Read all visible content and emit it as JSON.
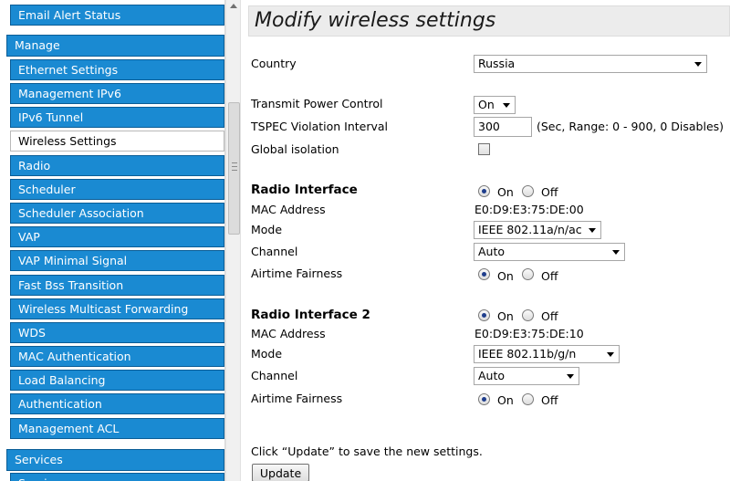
{
  "sidebar": {
    "items": [
      {
        "label": "Email Alert Status",
        "type": "item"
      },
      {
        "label": "Manage",
        "type": "group"
      },
      {
        "label": "Ethernet Settings",
        "type": "item"
      },
      {
        "label": "Management IPv6",
        "type": "item"
      },
      {
        "label": "IPv6 Tunnel",
        "type": "item"
      },
      {
        "label": "Wireless Settings",
        "type": "item",
        "selected": true
      },
      {
        "label": "Radio",
        "type": "item"
      },
      {
        "label": "Scheduler",
        "type": "item"
      },
      {
        "label": "Scheduler Association",
        "type": "item"
      },
      {
        "label": "VAP",
        "type": "item"
      },
      {
        "label": "VAP Minimal Signal",
        "type": "item"
      },
      {
        "label": "Fast Bss Transition",
        "type": "item"
      },
      {
        "label": "Wireless Multicast Forwarding",
        "type": "item"
      },
      {
        "label": "WDS",
        "type": "item"
      },
      {
        "label": "MAC Authentication",
        "type": "item"
      },
      {
        "label": "Load Balancing",
        "type": "item"
      },
      {
        "label": "Authentication",
        "type": "item"
      },
      {
        "label": "Management ACL",
        "type": "item"
      },
      {
        "label": "Services",
        "type": "group"
      },
      {
        "label": "Services",
        "type": "item"
      }
    ]
  },
  "main": {
    "title": "Modify wireless settings",
    "country": {
      "label": "Country",
      "value": "Russia"
    },
    "transmit_power": {
      "label": "Transmit Power Control",
      "value": "On"
    },
    "tspec": {
      "label": "TSPEC Violation Interval",
      "value": "300",
      "hint": "(Sec, Range: 0 - 900, 0 Disables)"
    },
    "global_isolation": {
      "label": "Global isolation",
      "checked": false
    },
    "radio1": {
      "title": "Radio Interface",
      "on_label": "On",
      "off_label": "Off",
      "state": "On",
      "mac_label": "MAC Address",
      "mac": "E0:D9:E3:75:DE:00",
      "mode_label": "Mode",
      "mode": "IEEE 802.11a/n/ac",
      "channel_label": "Channel",
      "channel": "Auto",
      "airtime_label": "Airtime Fairness",
      "airtime_state": "On"
    },
    "radio2": {
      "title": "Radio Interface 2",
      "on_label": "On",
      "off_label": "Off",
      "state": "On",
      "mac_label": "MAC Address",
      "mac": "E0:D9:E3:75:DE:10",
      "mode_label": "Mode",
      "mode": "IEEE 802.11b/g/n",
      "channel_label": "Channel",
      "channel": "Auto",
      "airtime_label": "Airtime Fairness",
      "airtime_state": "On"
    },
    "footer_text": "Click “Update” to save the new settings.",
    "update_label": "Update"
  },
  "colors": {
    "nav_blue": "#1a8ad2",
    "nav_border": "#0b5d96",
    "radio_dot": "#1f3e8c"
  },
  "icons": {
    "scroll_up": "triangle-up-icon",
    "scroll_grip": "grip-lines-icon",
    "dropdown": "chevron-down-icon"
  }
}
